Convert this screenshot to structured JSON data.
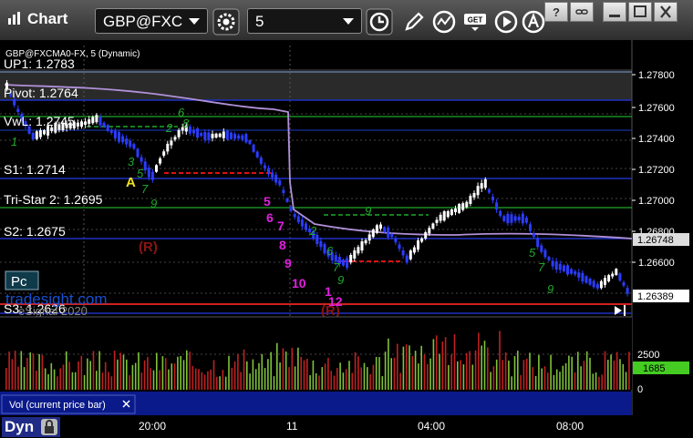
{
  "toolbar": {
    "app_title": "Chart",
    "symbol": "GBP@FXC",
    "interval": "5"
  },
  "chart": {
    "caption": "GBP@FXCMA0-FX, 5 (Dynamic)",
    "levels": {
      "up1": "UP1: 1.2783",
      "pivot": "Pivot: 1.2764",
      "vwl": "VwL: 1.2745",
      "s1": "S1: 1.2714",
      "tristar": "Tri-Star 2: 1.2695",
      "s2": "S2: 1.2675",
      "s3": "S3: 1.2626"
    },
    "price_ticks": [
      "1.27800",
      "1.27600",
      "1.27400",
      "1.27200",
      "1.27000",
      "1.26800",
      "1.26600"
    ],
    "price_markers": {
      "ma": "1.26748",
      "last": "1.26389"
    },
    "annotations": {
      "letter_a": "A",
      "reversal_1": "(R)",
      "reversal_2": "(R)",
      "count_5": "5",
      "count_6": "6",
      "count_7": "7",
      "count_8": "8",
      "count_9": "9",
      "count_10": "10",
      "count_11": "1",
      "count_12": "12"
    },
    "pc_button": "Pc",
    "watermark": "tradesight.com",
    "copyright": "eSignal 2020",
    "colors": {
      "bull": "#ffffff",
      "bear": "#2b3cff",
      "ma": "#b090d8",
      "up_vol": "#7fc23a",
      "down_vol": "#c02020"
    }
  },
  "volume": {
    "label": "Vol (current price bar)",
    "ticks": [
      "2500",
      "0"
    ],
    "current": "1685"
  },
  "time_axis": [
    "20:00",
    "11",
    "04:00",
    "08:00"
  ],
  "status": {
    "mode": "Dyn"
  }
}
